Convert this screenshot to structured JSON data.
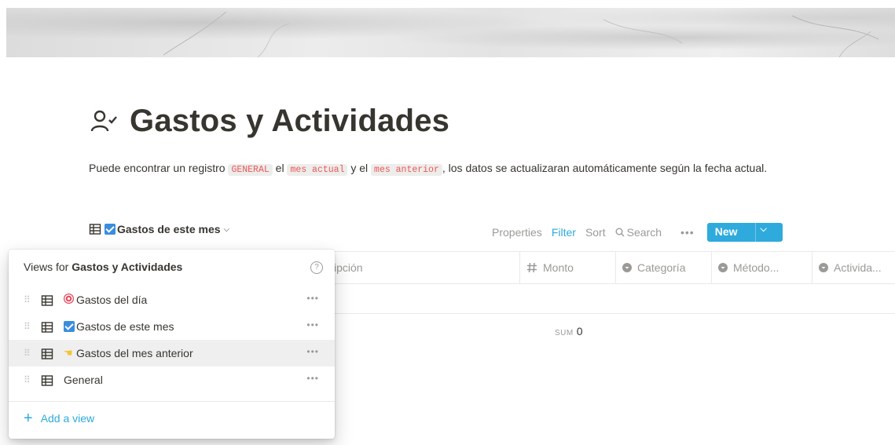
{
  "page": {
    "title": "Gastos y Actividades",
    "icon": "user-check-icon",
    "description": {
      "part1": "Puede encontrar un registro ",
      "code1": "GENERAL",
      "part2": " el ",
      "code2": "mes actual",
      "part3": " y el ",
      "code3": "mes anterior",
      "part4": ", los datos se actualizaran automáticamente según la fecha actual."
    }
  },
  "database": {
    "current_view": "Gastos de este mes",
    "toolbar": {
      "properties": "Properties",
      "filter": "Filter",
      "sort": "Sort",
      "search": "Search",
      "more": "•••",
      "new": "New"
    },
    "columns": [
      "ipción",
      "Monto",
      "Categoría",
      "Método...",
      "Activida..."
    ],
    "sum_label": "SUM",
    "sum_value": "0"
  },
  "views_menu": {
    "header_prefix": "Views for ",
    "header_db": "Gastos y Actividades",
    "items": [
      {
        "label": "Gastos del día",
        "emoji": "target-icon"
      },
      {
        "label": "Gastos de este mes",
        "emoji": "checkbox-icon"
      },
      {
        "label": "Gastos del mes anterior",
        "emoji": "pointing-hand-icon"
      },
      {
        "label": "General",
        "emoji": ""
      }
    ],
    "more": "•••",
    "add_view": "Add a view"
  },
  "colors": {
    "accent": "#2eaadc",
    "code_text": "#eb5757",
    "text": "#37352f",
    "muted": "#9b9a97"
  }
}
